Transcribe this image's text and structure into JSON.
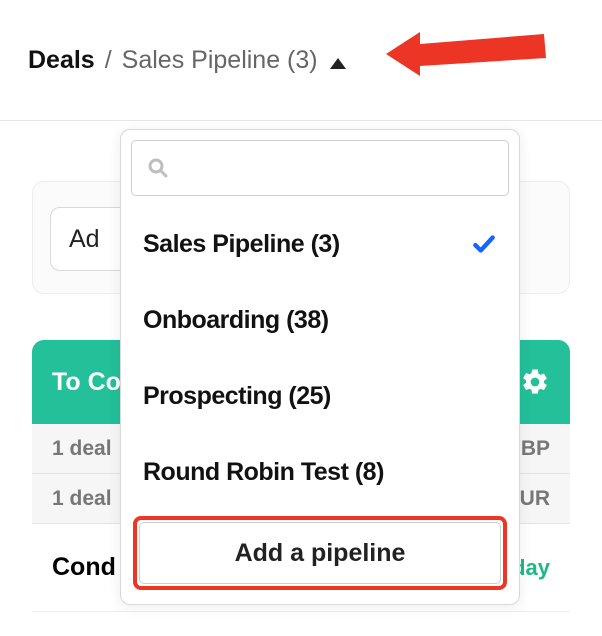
{
  "breadcrumb": {
    "root": "Deals",
    "separator": "/",
    "current": "Sales Pipeline (3)"
  },
  "below": {
    "add_button_visible_text": "Ad"
  },
  "column": {
    "title_visible": "To Co",
    "gear_icon": "gear-icon",
    "rows": [
      {
        "left": "1 deal",
        "right": "GBP"
      },
      {
        "left": "1 deal",
        "right": "EUR"
      }
    ],
    "card": {
      "title_visible": "Cond",
      "right_visible": "day"
    }
  },
  "dropdown": {
    "search_placeholder": "",
    "items": [
      {
        "label": "Sales Pipeline (3)",
        "selected": true
      },
      {
        "label": "Onboarding (38)",
        "selected": false
      },
      {
        "label": "Prospecting (25)",
        "selected": false
      },
      {
        "label": "Round Robin Test (8)",
        "selected": false
      }
    ],
    "add_label": "Add a pipeline"
  },
  "annotations": {
    "arrow_color": "#ec3524",
    "highlight_color": "#ec3524"
  }
}
